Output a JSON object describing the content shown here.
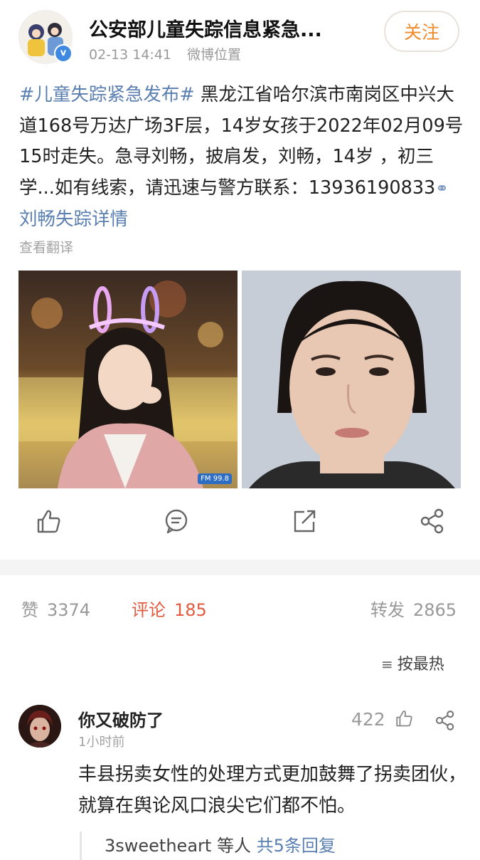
{
  "header": {
    "account_name": "公安部儿童失踪信息紧急...",
    "timestamp": "02-13 14:41",
    "location": "微博位置",
    "follow_label": "关注"
  },
  "post": {
    "hashtag": "#儿童失踪紧急发布#",
    "text": " 黑龙江省哈尔滨市南岗区中兴大道168号万达广场3F层，14岁女孩于2022年02月09号15时走失。急寻刘畅，披肩发，刘畅，14岁 ，初三学...如有线索，请迅速与警方联系：13936190833",
    "link_icon": "link-icon",
    "link_text": "刘畅失踪详情",
    "translate_label": "查看翻译",
    "photo_watermark": "FM 99.8"
  },
  "actions": {
    "icons": [
      "thumbs-up-icon",
      "comment-icon",
      "repost-icon",
      "share-icon"
    ]
  },
  "stats": {
    "likes_label": "赞",
    "likes_count": "3374",
    "comments_label": "评论",
    "comments_count": "185",
    "reposts_label": "转发",
    "reposts_count": "2865"
  },
  "sort": {
    "label": "按最热",
    "icon": "sort-icon"
  },
  "comment": {
    "user": "你又破防了",
    "time": "1小时前",
    "likes": "422",
    "text": "丰县拐卖女性的处理方式更加鼓舞了拐卖团伙，就算在舆论风口浪尖它们都不怕。",
    "reply_user": "3sweetheart",
    "reply_mid": " 等人 ",
    "reply_count_text": "共5条回复"
  },
  "colors": {
    "accent_orange": "#ef8a2a",
    "link_blue": "#5a7fb0",
    "comment_red": "#e25b3e",
    "verified_blue": "#3f8ae0"
  }
}
